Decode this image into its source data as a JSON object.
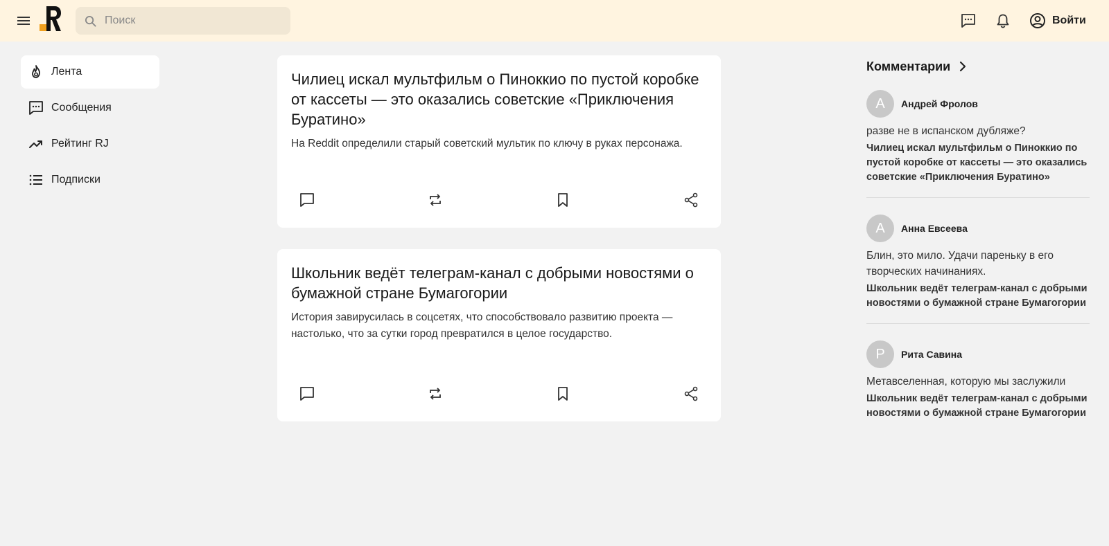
{
  "header": {
    "menu_icon": "hamburger-icon",
    "logo_icon": "rj-logo",
    "search": {
      "placeholder": "Поиск",
      "value": "",
      "icon": "search-icon"
    },
    "messages_icon": "chat-bubble-icon",
    "notifications_icon": "bell-icon",
    "login": {
      "label": "Войти",
      "icon": "user-circle-icon"
    },
    "background": "#fff4e0",
    "logo_accent": "#f0a01e"
  },
  "sidebar": {
    "items": [
      {
        "label": "Лента",
        "icon": "fire-icon",
        "active": true
      },
      {
        "label": "Сообщения",
        "icon": "chat-bubble-icon",
        "active": false
      },
      {
        "label": "Рейтинг RJ",
        "icon": "trending-up-icon",
        "active": false
      },
      {
        "label": "Подписки",
        "icon": "list-icon",
        "active": false
      }
    ]
  },
  "feed": {
    "actions": [
      "comment-icon",
      "repost-icon",
      "bookmark-icon",
      "share-icon"
    ],
    "articles": [
      {
        "title": "Чилиец искал мультфильм о Пиноккио по пустой коробке от кассеты — это оказались советские «Приключения Буратино»",
        "lead": "На Reddit определили старый советский мультик по ключу в руках персонажа."
      },
      {
        "title": "Школьник ведёт телеграм-канал с добрыми новостями о бумажной стране Бумагогории",
        "lead": "История завирусилась в соцсетях, что способствовало развитию проекта — настолько, что за сутки город превратился в целое государство."
      }
    ]
  },
  "comments": {
    "title": "Комментарии",
    "items": [
      {
        "avatar_letter": "А",
        "author": "Андрей Фролов",
        "text": "разве не в испанском дубляже?",
        "article": "Чилиец искал мультфильм о Пиноккио по пустой коробке от кассеты — это оказались советские «Приключения Буратино»"
      },
      {
        "avatar_letter": "А",
        "author": "Анна Евсеева",
        "text": "Блин, это мило. Удачи пареньку в его творческих начинаниях.",
        "article": "Школьник ведёт телеграм-канал с добрыми новостями о бумажной стране Бумагогории"
      },
      {
        "avatar_letter": "Р",
        "author": "Рита Савина",
        "text": "Метавселенная, которую мы заслужили",
        "article": "Школьник ведёт телеграм-канал с добрыми новостями о бумажной стране Бумагогории"
      }
    ]
  }
}
